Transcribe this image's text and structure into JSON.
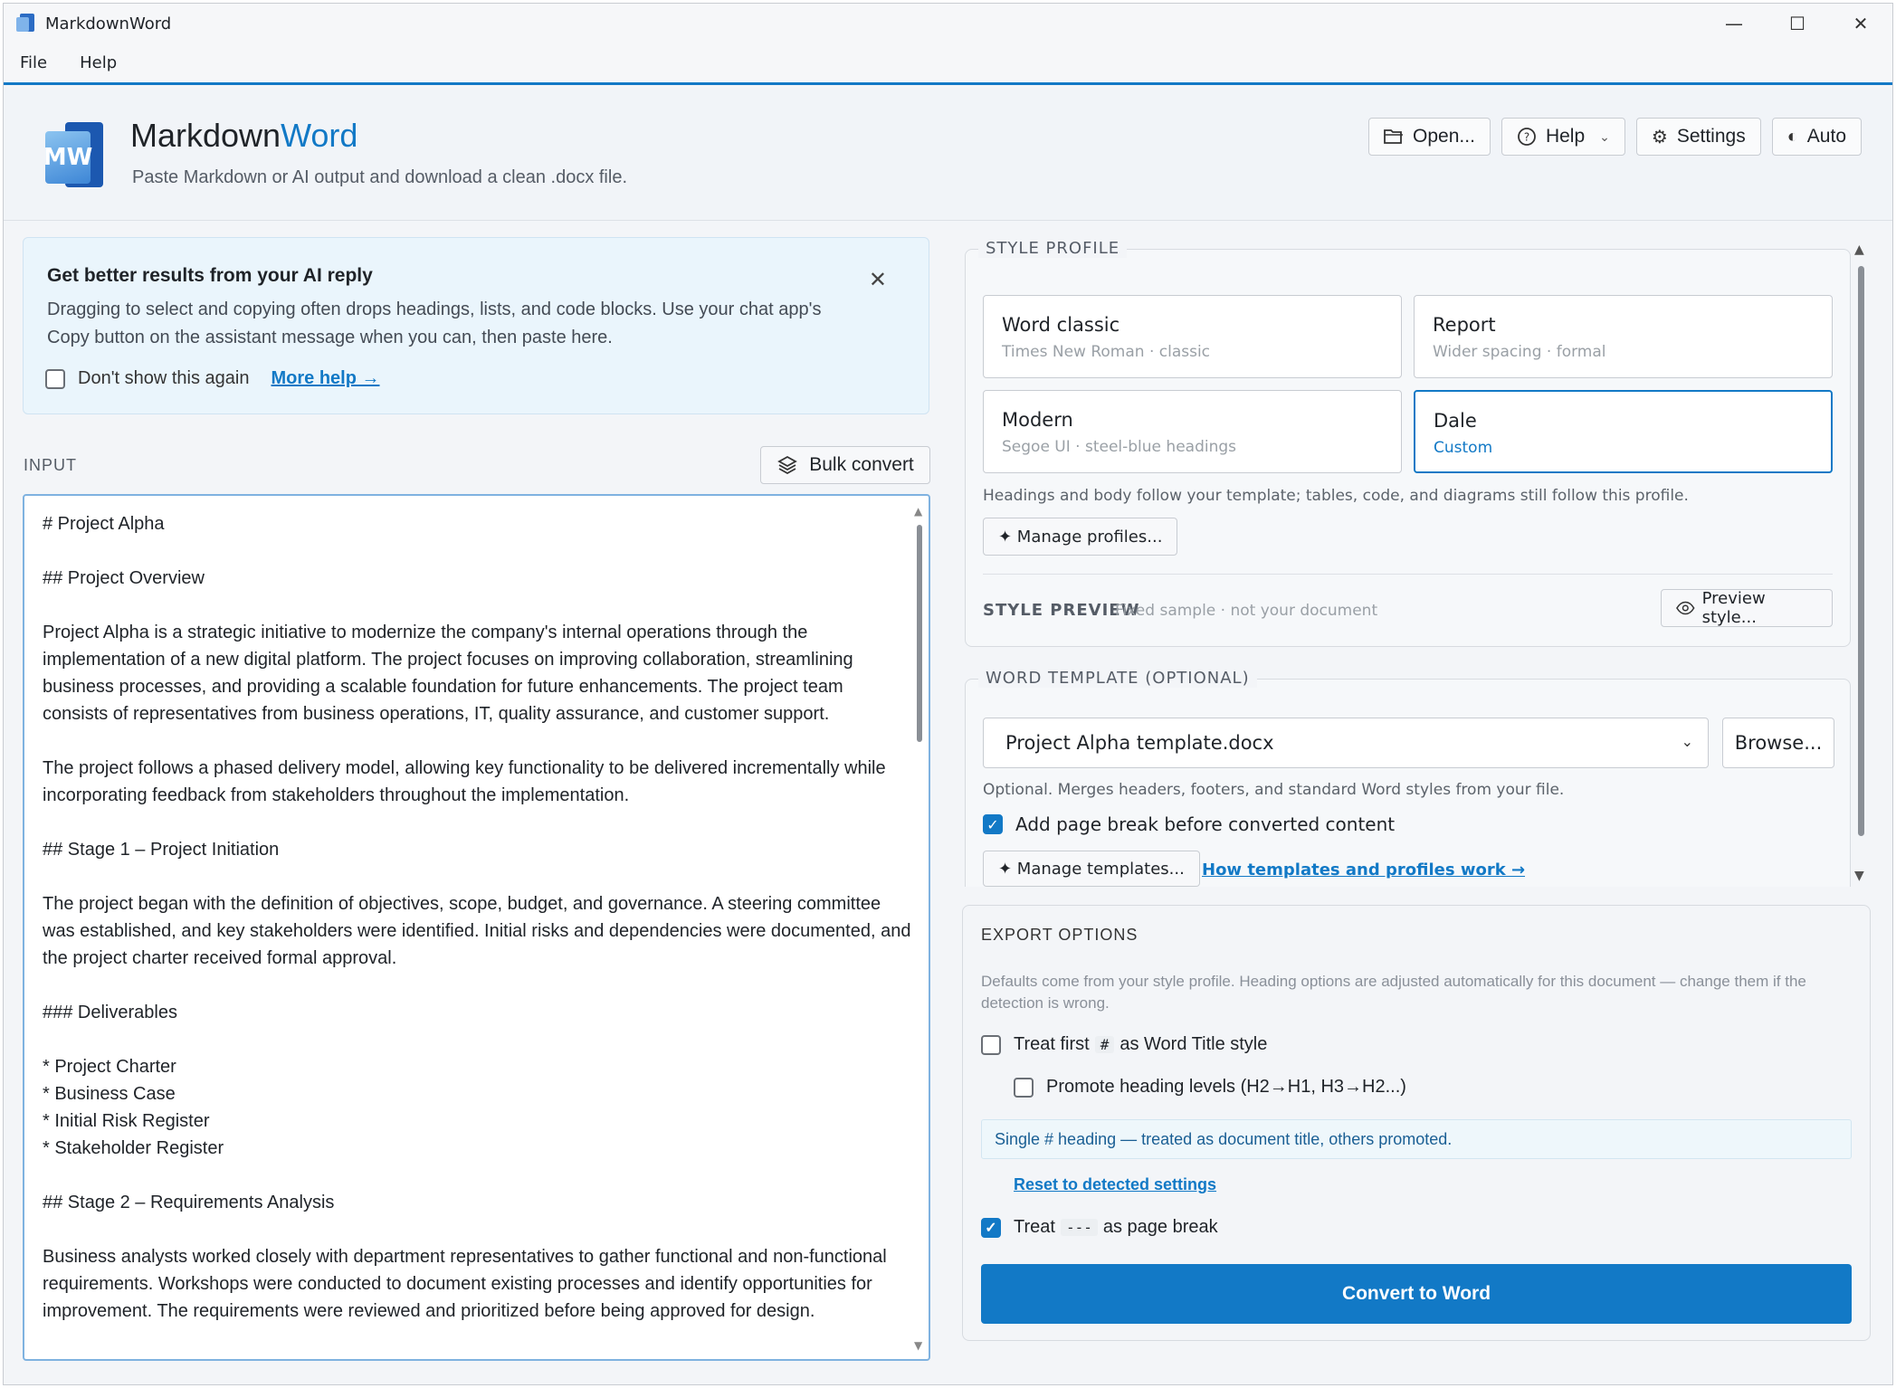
{
  "window": {
    "title": "MarkdownWord",
    "controls": {
      "minimize": "—",
      "maximize": "☐",
      "close": "✕"
    }
  },
  "menu": [
    "File",
    "Help"
  ],
  "header": {
    "brand_part1": "Markdown",
    "brand_part2": "Word",
    "logo_letters": "MW",
    "tagline": "Paste Markdown or AI output and download a clean .docx file.",
    "buttons": {
      "open": "Open...",
      "help": "Help",
      "settings": "Settings",
      "auto": "Auto"
    }
  },
  "tip": {
    "title": "Get better results from your AI reply",
    "body": "Dragging to select and copying often drops headings, lists, and code blocks. Use your chat app's Copy button on the assistant message when you can, then paste here.",
    "dont_show": "Don't show this again",
    "more_help": "More help →"
  },
  "input": {
    "label": "INPUT",
    "bulk_convert": "Bulk convert",
    "text": "# Project Alpha\n\n## Project Overview\n\nProject Alpha is a strategic initiative to modernize the company's internal operations through the implementation of a new digital platform. The project focuses on improving collaboration, streamlining business processes, and providing a scalable foundation for future enhancements. The project team consists of representatives from business operations, IT, quality assurance, and customer support.\n\nThe project follows a phased delivery model, allowing key functionality to be delivered incrementally while incorporating feedback from stakeholders throughout the implementation.\n\n## Stage 1 – Project Initiation\n\nThe project began with the definition of objectives, scope, budget, and governance. A steering committee was established, and key stakeholders were identified. Initial risks and dependencies were documented, and the project charter received formal approval.\n\n### Deliverables\n\n* Project Charter\n* Business Case\n* Initial Risk Register\n* Stakeholder Register\n\n## Stage 2 – Requirements Analysis\n\nBusiness analysts worked closely with department representatives to gather functional and non-functional requirements. Workshops were conducted to document existing processes and identify opportunities for improvement. The requirements were reviewed and prioritized before being approved for design."
  },
  "style_profile": {
    "legend": "STYLE PROFILE",
    "profiles": [
      {
        "name": "Word classic",
        "desc": "Times New Roman · classic",
        "selected": false
      },
      {
        "name": "Report",
        "desc": "Wider spacing · formal",
        "selected": false
      },
      {
        "name": "Modern",
        "desc": "Segoe UI · steel-blue headings",
        "selected": false
      },
      {
        "name": "Dale",
        "desc": "Custom",
        "selected": true
      }
    ],
    "note": "Headings and body follow your template; tables, code, and diagrams still follow this profile.",
    "manage_profiles": "✦ Manage profiles...",
    "preview_label": "STYLE PREVIEW",
    "preview_sub": "Fixed sample · not your document",
    "preview_button": "Preview style..."
  },
  "template": {
    "legend": "WORD TEMPLATE (OPTIONAL)",
    "selected": "Project Alpha template.docx",
    "browse": "Browse...",
    "note": "Optional. Merges headers, footers, and standard Word styles from your file.",
    "page_break_label": "Add page break before converted content",
    "page_break_checked": true,
    "manage_templates": "✦ Manage templates...",
    "how_link": "How templates and profiles work →"
  },
  "export": {
    "title": "EXPORT OPTIONS",
    "desc": "Defaults come from your style profile. Heading options are adjusted automatically for this document — change them if the detection is wrong.",
    "treat_first_pre": "Treat first",
    "treat_first_code": "#",
    "treat_first_post": "as Word Title style",
    "treat_first_checked": false,
    "promote_label": "Promote heading levels (H2→H1, H3→H2...)",
    "promote_checked": false,
    "info": "Single # heading — treated as document title, others promoted.",
    "reset_link": "Reset to detected settings",
    "treat_break_pre": "Treat",
    "treat_break_code": "---",
    "treat_break_post": "as page break",
    "treat_break_checked": true,
    "convert_button": "Convert to Word"
  },
  "colors": {
    "accent": "#1279c6",
    "tip_bg": "#eaf5fc"
  }
}
